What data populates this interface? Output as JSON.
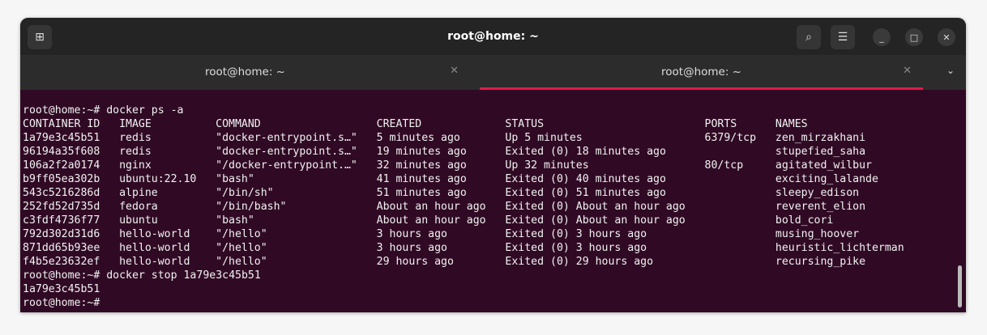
{
  "window": {
    "title": "root@home: ~"
  },
  "header": {
    "new_tab_icon": "new-tab-icon",
    "search_icon": "search-icon",
    "menu_icon": "hamburger-icon",
    "minimize": "_",
    "maximize": "□",
    "close": "✕"
  },
  "tabs": [
    {
      "label": "root@home: ~",
      "active": false
    },
    {
      "label": "root@home: ~",
      "active": true
    }
  ],
  "accent": "#e01b4b",
  "terminal": {
    "prompt": "root@home:~#",
    "cmd1": " docker ps -a",
    "headers": [
      "CONTAINER ID",
      "IMAGE",
      "COMMAND",
      "CREATED",
      "STATUS",
      "PORTS",
      "NAMES"
    ],
    "rows": [
      [
        "1a79e3c45b51",
        "redis",
        "\"docker-entrypoint.s…\"",
        "5 minutes ago",
        "Up 5 minutes",
        "6379/tcp",
        "zen_mirzakhani"
      ],
      [
        "96194a35f608",
        "redis",
        "\"docker-entrypoint.s…\"",
        "19 minutes ago",
        "Exited (0) 18 minutes ago",
        "",
        "stupefied_saha"
      ],
      [
        "106a2f2a0174",
        "nginx",
        "\"/docker-entrypoint.…\"",
        "32 minutes ago",
        "Up 32 minutes",
        "80/tcp",
        "agitated_wilbur"
      ],
      [
        "b9ff05ea302b",
        "ubuntu:22.10",
        "\"bash\"",
        "41 minutes ago",
        "Exited (0) 40 minutes ago",
        "",
        "exciting_lalande"
      ],
      [
        "543c5216286d",
        "alpine",
        "\"/bin/sh\"",
        "51 minutes ago",
        "Exited (0) 51 minutes ago",
        "",
        "sleepy_edison"
      ],
      [
        "252fd52d735d",
        "fedora",
        "\"/bin/bash\"",
        "About an hour ago",
        "Exited (0) About an hour ago",
        "",
        "reverent_elion"
      ],
      [
        "c3fdf4736f77",
        "ubuntu",
        "\"bash\"",
        "About an hour ago",
        "Exited (0) About an hour ago",
        "",
        "bold_cori"
      ],
      [
        "792d302d31d6",
        "hello-world",
        "\"/hello\"",
        "3 hours ago",
        "Exited (0) 3 hours ago",
        "",
        "musing_hoover"
      ],
      [
        "871dd65b93ee",
        "hello-world",
        "\"/hello\"",
        "3 hours ago",
        "Exited (0) 3 hours ago",
        "",
        "heuristic_lichterman"
      ],
      [
        "f4b5e23632ef",
        "hello-world",
        "\"/hello\"",
        "29 hours ago",
        "Exited (0) 29 hours ago",
        "",
        "recursing_pike"
      ]
    ],
    "cmd2": " docker stop 1a79e3c45b51",
    "output2": "1a79e3c45b51"
  }
}
